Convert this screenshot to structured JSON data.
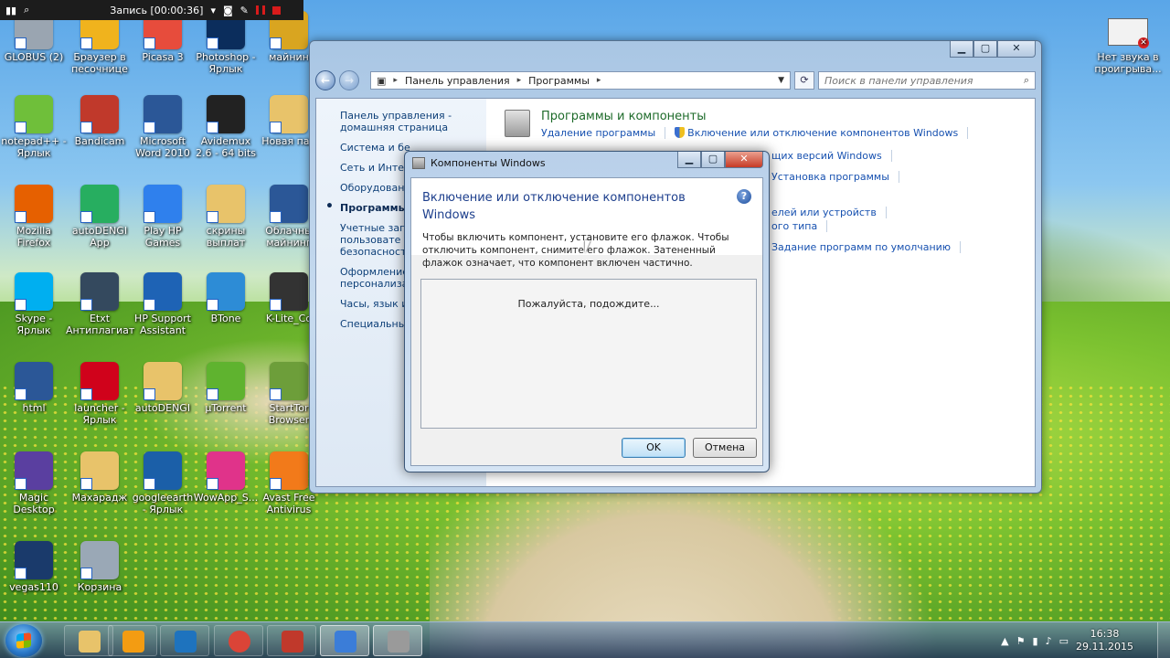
{
  "recorder": {
    "status": "Запись [00:00:36]"
  },
  "desktop_icons": [
    {
      "label": "GLOBUS (2)",
      "color": "#9aa5b1"
    },
    {
      "label": "Браузер в песочнице",
      "color": "#f0b31d"
    },
    {
      "label": "Picasa 3",
      "color": "#e74c3c"
    },
    {
      "label": "Photoshop - Ярлык",
      "color": "#0b2d5c"
    },
    {
      "label": "майнин",
      "color": "#d9a520"
    },
    {
      "label": "notepad++ - Ярлык",
      "color": "#6fbf3a"
    },
    {
      "label": "Bandicam",
      "color": "#c0392b"
    },
    {
      "label": "Microsoft Word 2010",
      "color": "#2b5797"
    },
    {
      "label": "Avidemux 2.6 - 64 bits",
      "color": "#222222"
    },
    {
      "label": "Новая пап",
      "color": "#e8c36a"
    },
    {
      "label": "Mozilla Firefox",
      "color": "#e66000"
    },
    {
      "label": "autoDENGI App",
      "color": "#27ae60"
    },
    {
      "label": "Play HP Games",
      "color": "#2f80ed"
    },
    {
      "label": "скрины выплат",
      "color": "#e8c36a"
    },
    {
      "label": "Облачны майнинг",
      "color": "#2b5797"
    },
    {
      "label": "Skype - Ярлык",
      "color": "#00aff0"
    },
    {
      "label": "Etxt Антиплагиат",
      "color": "#34495e"
    },
    {
      "label": "HP Support Assistant",
      "color": "#1e63b5"
    },
    {
      "label": "BTone",
      "color": "#2d8cd6"
    },
    {
      "label": "K-Lite_Co",
      "color": "#333333"
    },
    {
      "label": "html",
      "color": "#2b5797"
    },
    {
      "label": "launcher - Ярлык",
      "color": "#d0021b"
    },
    {
      "label": "autoDENGI",
      "color": "#e8c36a"
    },
    {
      "label": "µTorrent",
      "color": "#5fb32f"
    },
    {
      "label": "StartTor Browser",
      "color": "#6d9e3a"
    },
    {
      "label": "Magic Desktop",
      "color": "#5a3fa0"
    },
    {
      "label": "Махарадж",
      "color": "#e8c36a"
    },
    {
      "label": "googleearth - Ярлык",
      "color": "#1b5fa8"
    },
    {
      "label": "WowApp_S...",
      "color": "#e0338a"
    },
    {
      "label": "Avast Free Antivirus",
      "color": "#f27a1a"
    },
    {
      "label": "vegas110",
      "color": "#1a3a6b"
    },
    {
      "label": "Корзина",
      "color": "#9aa8b6"
    }
  ],
  "tray_note": {
    "label": "Нет звука в проигрыва..."
  },
  "explorer": {
    "breadcrumb": [
      "Панель управления",
      "Программы"
    ],
    "search_placeholder": "Поиск в панели управления",
    "left_nav": [
      {
        "label": "Панель управления -\nдомашняя страница",
        "active": false
      },
      {
        "label": "Система и бе",
        "active": false
      },
      {
        "label": "Сеть и Интер",
        "active": false
      },
      {
        "label": "Оборудовани",
        "active": false
      },
      {
        "label": "Программы",
        "active": true
      },
      {
        "label": "Учетные запи\nпользовате\nбезопасность",
        "active": false
      },
      {
        "label": "Оформление\nперсонализа",
        "active": false
      },
      {
        "label": "Часы, язык и",
        "active": false
      },
      {
        "label": "Специальные",
        "active": false
      }
    ],
    "section_title": "Программы и компоненты",
    "links_row1": [
      "Удаление программы",
      "Включение или отключение компонентов Windows"
    ],
    "links_row2": [
      "щих версий Windows",
      "Установка программы"
    ],
    "links_row3": [
      "елей или устройств"
    ],
    "links_row4": [
      "ого типа",
      "Задание программ по умолчанию"
    ]
  },
  "dialog": {
    "title": "Компоненты Windows",
    "heading": "Включение или отключение компонентов Windows",
    "description": "Чтобы включить компонент, установите его флажок. Чтобы отключить компонент, снимите его флажок. Затененный флажок означает, что компонент включен частично.",
    "waiting": "Пожалуйста, подождите...",
    "ok_label": "OK",
    "cancel_label": "Отмена"
  },
  "taskbar": {
    "time": "16:38",
    "date": "29.11.2015",
    "apps": [
      {
        "name": "explorer",
        "color": "#e8c36a"
      },
      {
        "name": "media-player",
        "color": "#f39c12"
      },
      {
        "name": "internet-explorer",
        "color": "#1e73be"
      },
      {
        "name": "chrome",
        "color": "#db4437"
      },
      {
        "name": "bandicam",
        "color": "#c0392b"
      },
      {
        "name": "control-panel",
        "color": "#3b7dd8"
      },
      {
        "name": "windows-features",
        "color": "#9a9a9a"
      }
    ]
  }
}
